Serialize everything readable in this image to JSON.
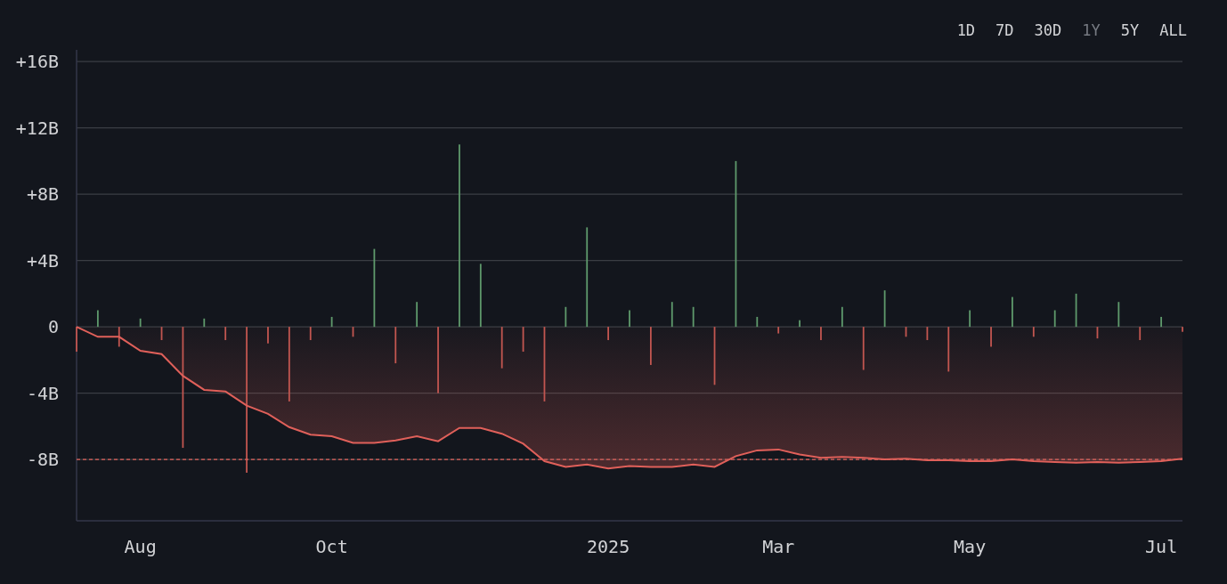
{
  "range_tabs": [
    {
      "label": "1D",
      "selected": false
    },
    {
      "label": "7D",
      "selected": false
    },
    {
      "label": "30D",
      "selected": false
    },
    {
      "label": "1Y",
      "selected": true
    },
    {
      "label": "5Y",
      "selected": false
    },
    {
      "label": "ALL",
      "selected": false
    }
  ],
  "chart": {
    "chart_data": {
      "type": "bar",
      "categories": [
        null,
        null,
        null,
        "Aug",
        null,
        null,
        null,
        null,
        null,
        null,
        null,
        null,
        "Oct",
        null,
        null,
        null,
        null,
        null,
        null,
        null,
        null,
        null,
        null,
        null,
        null,
        "2025",
        null,
        null,
        null,
        null,
        null,
        null,
        null,
        "Mar",
        null,
        null,
        null,
        null,
        null,
        null,
        null,
        null,
        "May",
        null,
        null,
        null,
        null,
        null,
        null,
        null,
        null,
        "Jul",
        null
      ],
      "series": [
        {
          "type": "bar",
          "color": "#5f9a6c",
          "values": [
            null,
            1.0,
            null,
            0.5,
            null,
            null,
            0.5,
            null,
            null,
            null,
            null,
            null,
            0.6,
            null,
            4.7,
            null,
            1.5,
            null,
            11.0,
            3.8,
            null,
            null,
            null,
            1.2,
            6.0,
            null,
            1.0,
            null,
            1.5,
            1.2,
            null,
            10.0,
            0.6,
            null,
            0.4,
            null,
            1.2,
            null,
            2.2,
            null,
            null,
            null,
            1.0,
            null,
            1.8,
            null,
            1.0,
            2.0,
            null,
            1.5,
            null,
            0.6,
            null
          ]
        },
        {
          "type": "bar",
          "color": "#c25650",
          "values": [
            -1.5,
            null,
            -1.2,
            null,
            -0.8,
            -7.3,
            null,
            -0.8,
            -8.8,
            -1.0,
            -4.5,
            -0.8,
            null,
            -0.6,
            null,
            -2.2,
            null,
            -4.0,
            null,
            null,
            -2.5,
            -1.5,
            -4.5,
            null,
            null,
            -0.8,
            null,
            -2.3,
            null,
            null,
            -3.5,
            null,
            null,
            -0.4,
            null,
            -0.8,
            null,
            -2.6,
            null,
            -0.6,
            -0.8,
            -2.7,
            null,
            -1.2,
            null,
            -0.6,
            null,
            null,
            -0.7,
            null,
            -0.8,
            null,
            -0.3
          ]
        },
        {
          "type": "line",
          "color": "#e0605a",
          "values": [
            0,
            -0.6,
            -0.6,
            -1.45,
            -1.65,
            -2.95,
            -3.8,
            -3.9,
            -4.75,
            -5.25,
            -6.05,
            -6.5,
            -6.6,
            -7.0,
            -7.0,
            -6.85,
            -6.6,
            -6.9,
            -6.1,
            -6.1,
            -6.45,
            -7.05,
            -8.1,
            -8.45,
            -8.3,
            -8.55,
            -8.4,
            -8.45,
            -8.45,
            -8.3,
            -8.45,
            -7.8,
            -7.45,
            -7.4,
            -7.7,
            -7.9,
            -7.85,
            -7.9,
            -8.0,
            -7.95,
            -8.05,
            -8.05,
            -8.1,
            -8.1,
            -8.0,
            -8.1,
            -8.15,
            -8.2,
            -8.15,
            -8.2,
            -8.15,
            -8.1,
            -7.95
          ]
        }
      ],
      "ylim": [
        -11.7,
        16.6
      ],
      "grid": true,
      "yticks": [
        {
          "value": -8,
          "label": "-8B"
        },
        {
          "value": -4,
          "label": "-4B"
        },
        {
          "value": 0,
          "label": "0"
        },
        {
          "value": 4,
          "label": "+4B"
        },
        {
          "value": 8,
          "label": "+8B"
        },
        {
          "value": 12,
          "label": "+12B"
        },
        {
          "value": 16,
          "label": "+16B"
        }
      ],
      "ref_lines": [
        {
          "axis": "y",
          "value": -8,
          "color": "#e0605a"
        }
      ]
    }
  }
}
